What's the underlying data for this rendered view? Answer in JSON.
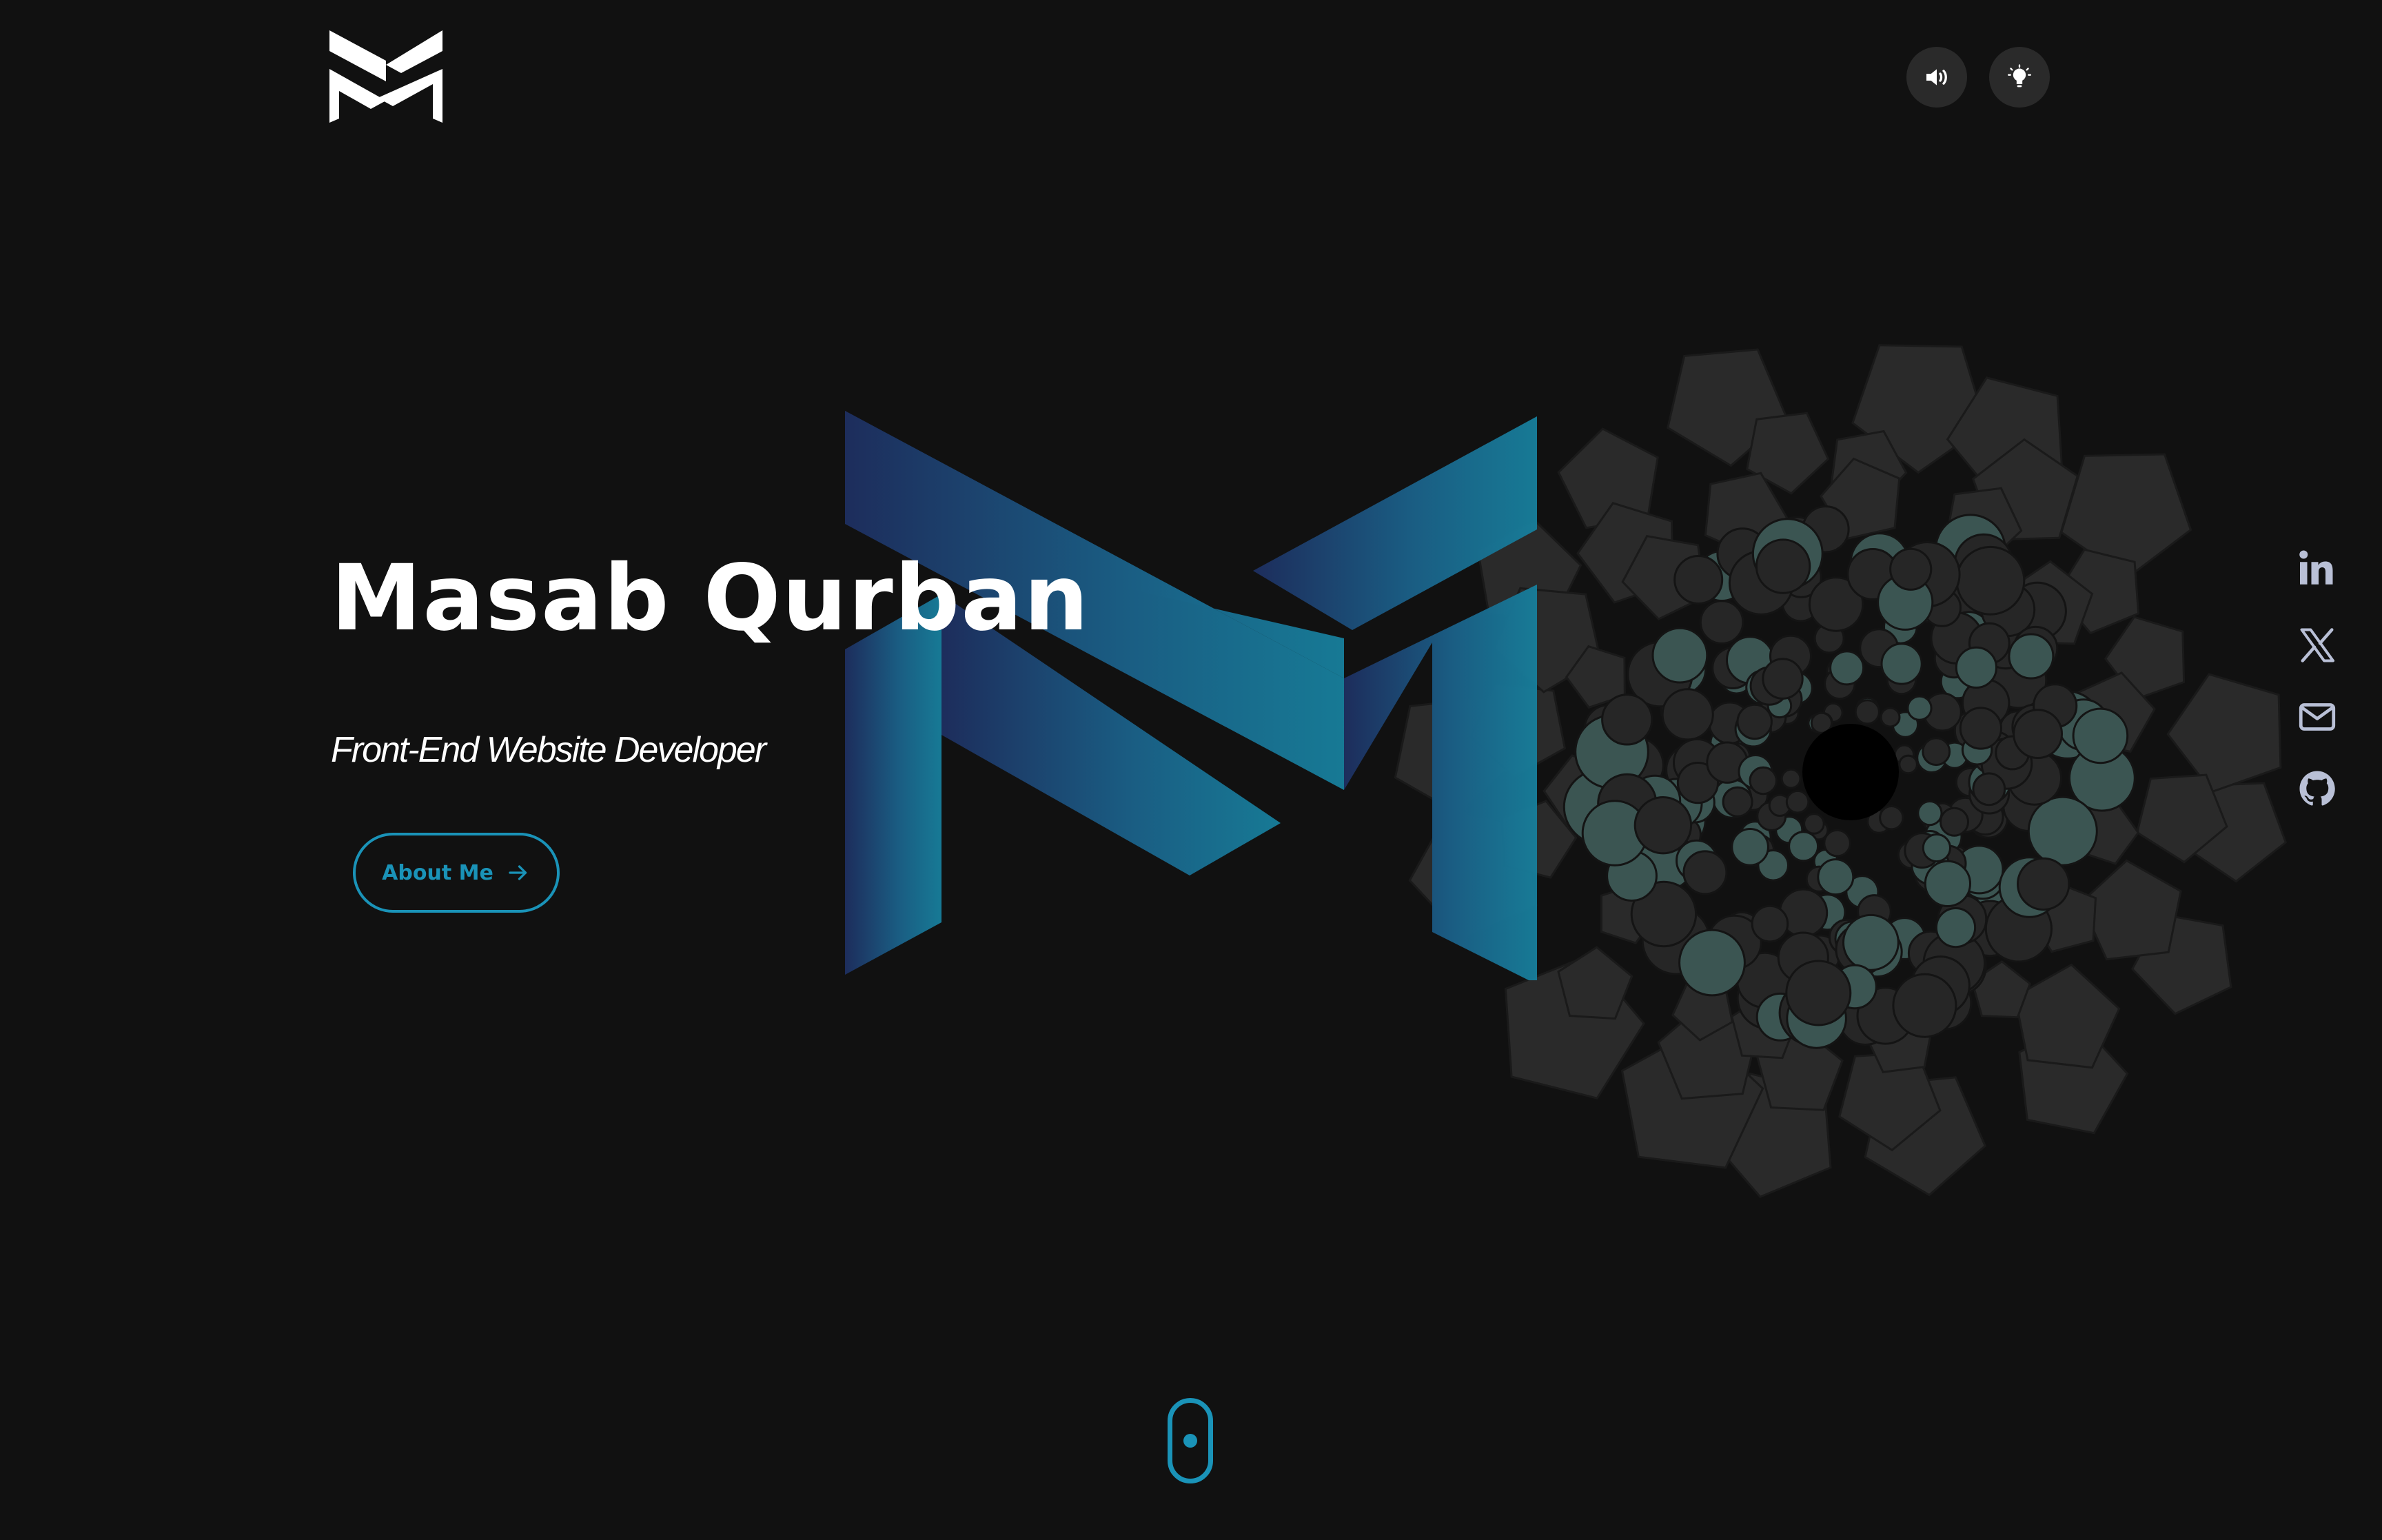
{
  "brand": {
    "logo_label": "MQ logo",
    "accent_color": "#1a93b8",
    "gradient_start": "#1d2d5c",
    "gradient_end": "#177f9c",
    "background": "#111111"
  },
  "header": {
    "sound_icon": "speaker-icon",
    "theme_icon": "lightbulb-icon"
  },
  "hero": {
    "name": "Masab Qurban",
    "role": "Front-End Website Developer",
    "cta_label": "About Me",
    "cta_icon": "arrow-right-icon"
  },
  "social": [
    {
      "name": "linkedin",
      "icon": "linkedin-icon"
    },
    {
      "name": "x",
      "icon": "x-icon"
    },
    {
      "name": "email",
      "icon": "mail-icon"
    },
    {
      "name": "github",
      "icon": "github-icon"
    }
  ],
  "scroll": {
    "icon": "mouse-scroll-icon"
  }
}
